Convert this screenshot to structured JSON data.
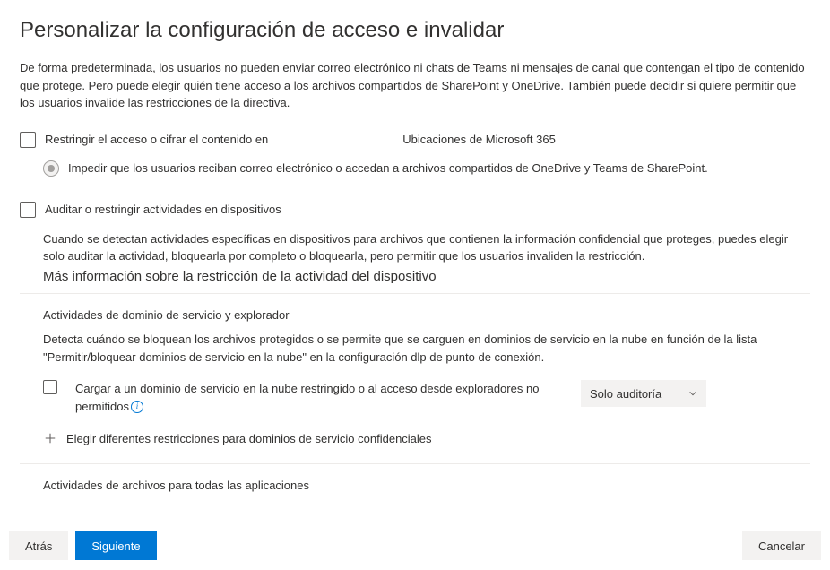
{
  "title": "Personalizar la configuración de acceso e invalidar",
  "intro": "De forma predeterminada, los usuarios no pueden enviar correo electrónico ni chats de Teams ni mensajes de canal que contengan el tipo de contenido que protege. Pero puede elegir quién tiene acceso a los archivos compartidos de SharePoint y OneDrive. También puede decidir si quiere permitir que los usuarios invalide las restricciones de la directiva.",
  "restrict": {
    "label": "Restringir el acceso o cifrar el contenido en",
    "sublabel": "Ubicaciones de Microsoft 365",
    "radio_label": "Impedir que los usuarios reciban correo electrónico o accedan a archivos compartidos de OneDrive y Teams de SharePoint."
  },
  "audit": {
    "label": "Auditar o restringir actividades en dispositivos",
    "desc": "Cuando se detectan actividades específicas en dispositivos para archivos que contienen la información confidencial que proteges, puedes elegir solo auditar la actividad, bloquearla por completo o bloquearla, pero permitir que los usuarios invaliden la restricción.",
    "more_info": "Más información sobre la restricción de la actividad del dispositivo"
  },
  "domain_section": {
    "title": "Actividades de dominio de servicio y explorador",
    "desc": "Detecta cuándo se bloquean los archivos protegidos o se permite que se carguen en dominios de servicio en la nube en función de la lista \"Permitir/bloquear dominios de servicio en la nube\" en la configuración dlp de punto de conexión.",
    "upload_label": "Cargar a un dominio de servicio en la nube restringido o al acceso desde exploradores no permitidos",
    "dropdown_value": "Solo auditoría",
    "add_label": "Elegir diferentes restricciones para dominios de servicio confidenciales"
  },
  "files_section": {
    "title": "Actividades de archivos para todas las aplicaciones"
  },
  "footer": {
    "back": "Atrás",
    "next": "Siguiente",
    "cancel": "Cancelar"
  }
}
